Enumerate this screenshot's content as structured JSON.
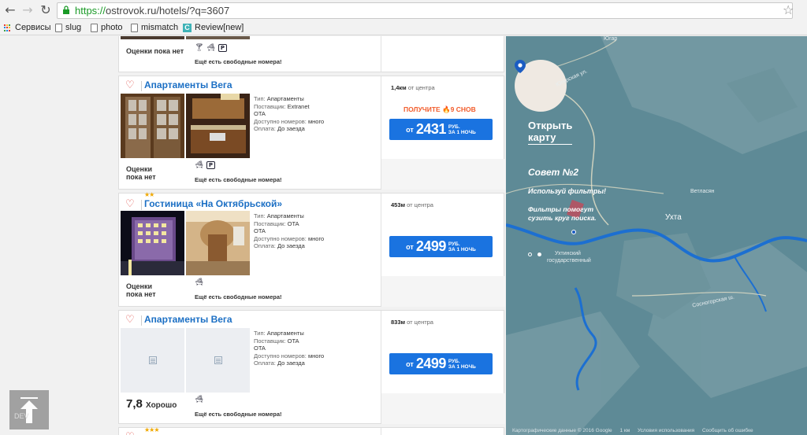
{
  "browser": {
    "url_scheme": "https://",
    "url_rest": "ostrovok.ru/hotels/?q=3607",
    "bookmarks": [
      {
        "label": "Сервисы",
        "icon": "apps-grid-icon"
      },
      {
        "label": "slug",
        "icon": "document-icon"
      },
      {
        "label": "photo",
        "icon": "document-icon"
      },
      {
        "label": "mismatch",
        "icon": "document-icon"
      },
      {
        "label": "Review[new]",
        "icon": "review-icon"
      }
    ]
  },
  "common": {
    "free_rooms": "Ещё есть свободные номера!",
    "no_rating": "Оценки\nпока нет",
    "from": "от",
    "currency_line1": "РУБ.",
    "currency_line2": "ЗА 1 НОЧЬ",
    "from_center": "от центра"
  },
  "hotels": [
    {
      "name": "",
      "rating": "Оценки пока нет",
      "amenities": [
        "cocktail-icon",
        "bath-icon",
        "parking-icon"
      ]
    },
    {
      "name": "Апартаменты Вега",
      "stars": "",
      "type_label": "Тип:",
      "type": "Апартаменты",
      "supplier_label": "Поставщик:",
      "supplier": "Extranet",
      "supplier2": "OTA",
      "avail_label": "Доступно номеров:",
      "avail": "много",
      "payment_label": "Оплата:",
      "payment": "До заезда",
      "distance": "1,4км",
      "promo": "ПОЛУЧИТЕ 🔥9 СНОВ",
      "price": "2431",
      "rating": "Оценки пока нет",
      "amenities": [
        "bath-icon",
        "parking-icon"
      ]
    },
    {
      "name": "Гостиница «На Октябрьской»",
      "stars": "★★",
      "type_label": "Тип:",
      "type": "Апартаменты",
      "supplier_label": "Поставщик:",
      "supplier": "OTA",
      "supplier2": "OTA",
      "avail_label": "Доступно номеров:",
      "avail": "много",
      "payment_label": "Оплата:",
      "payment": "До заезда",
      "distance": "453м",
      "price": "2499",
      "rating": "Оценки пока нет",
      "amenities": [
        "bath-icon"
      ]
    },
    {
      "name": "Апартаменты Вега",
      "stars": "",
      "type_label": "Тип:",
      "type": "Апартаменты",
      "supplier_label": "Поставщик:",
      "supplier": "OTA",
      "supplier2": "OTA",
      "avail_label": "Доступно номеров:",
      "avail": "много",
      "payment_label": "Оплата:",
      "payment": "До заезда",
      "distance": "833м",
      "price": "2499",
      "rating_score": "7,8",
      "rating_word": "Хорошо",
      "amenities": [
        "bath-icon"
      ]
    },
    {
      "stars": "★★★"
    }
  ],
  "map": {
    "open_line1": "Открыть",
    "open_line2": "карту",
    "tip_title": "Совет №2",
    "tip_subtitle": "Используй фильтры!",
    "tip_text_line1": "Фильтры помогут",
    "tip_text_line2": "сузить круг поиска.",
    "labels": {
      "yugar": "Югар",
      "yugerskaya": "Югерская ул.",
      "vetlasyan": "Ветласян",
      "ukhta": "Ухта",
      "univ1": "Ухтинский",
      "univ2": "государственный",
      "sosnogorskaya": "Сосногорская ш."
    },
    "footer": [
      "Картографические данные © 2016 Google",
      "1 км",
      "Условия использования",
      "Сообщить об ошибке"
    ]
  },
  "widgets": {
    "scroll_top_badge": "DEV"
  },
  "colors": {
    "brand_blue": "#1a73e0",
    "link_blue": "#1b6fc4",
    "promo_orange": "#f25c2b",
    "map_teal": "#5e8a96"
  }
}
